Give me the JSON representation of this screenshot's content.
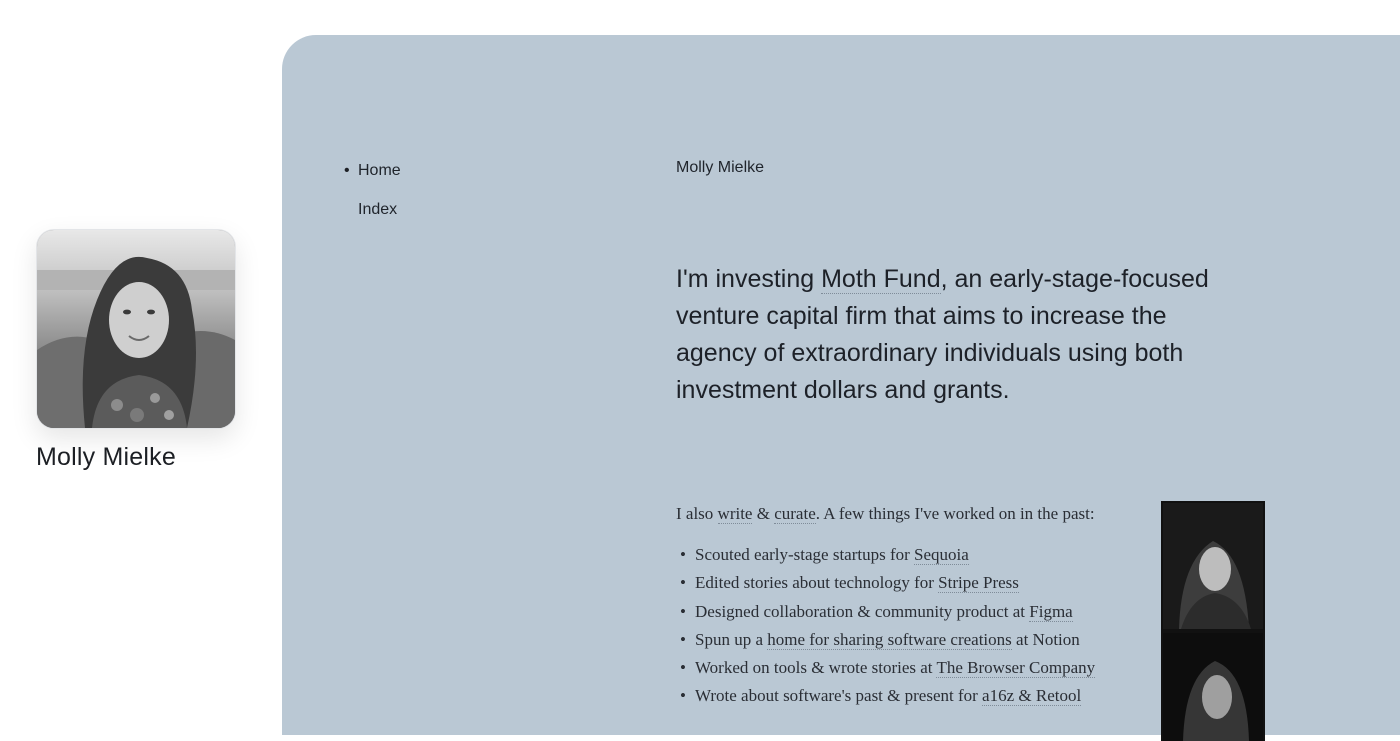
{
  "profile": {
    "name": "Molly Mielke",
    "avatar_icon": "portrait-photo"
  },
  "nav": {
    "items": [
      {
        "label": "Home",
        "active": true
      },
      {
        "label": "Index",
        "active": false
      }
    ]
  },
  "header": {
    "site_name": "Molly Mielke"
  },
  "intro": {
    "before": "I'm investing ",
    "link": "Moth Fund",
    "after": ", an early-stage-focused venture capital firm that aims to increase the agency of extraordinary individuals using both investment dollars and grants."
  },
  "secondary": {
    "prefix": "I also ",
    "link_write": "write",
    "amp": " & ",
    "link_curate": "curate",
    "suffix": ". A few things I've worked on in the past:"
  },
  "past_work": [
    {
      "text": "Scouted early-stage startups for ",
      "link": "Sequoia",
      "after": ""
    },
    {
      "text": "Edited stories about technology for ",
      "link": "Stripe Press",
      "after": ""
    },
    {
      "text": "Designed collaboration & community product at ",
      "link": "Figma",
      "after": ""
    },
    {
      "text": "Spun up a ",
      "link": "home for sharing software creations",
      "after": " at Notion"
    },
    {
      "text": "Worked on tools & wrote stories at ",
      "link": "The Browser Company",
      "after": ""
    },
    {
      "text": "Wrote about software's past & present for ",
      "link": "a16z & Retool",
      "after": ""
    }
  ],
  "colors": {
    "panel": "#bac8d4",
    "text": "#1e2126",
    "link_underline": "#7f8c99"
  }
}
